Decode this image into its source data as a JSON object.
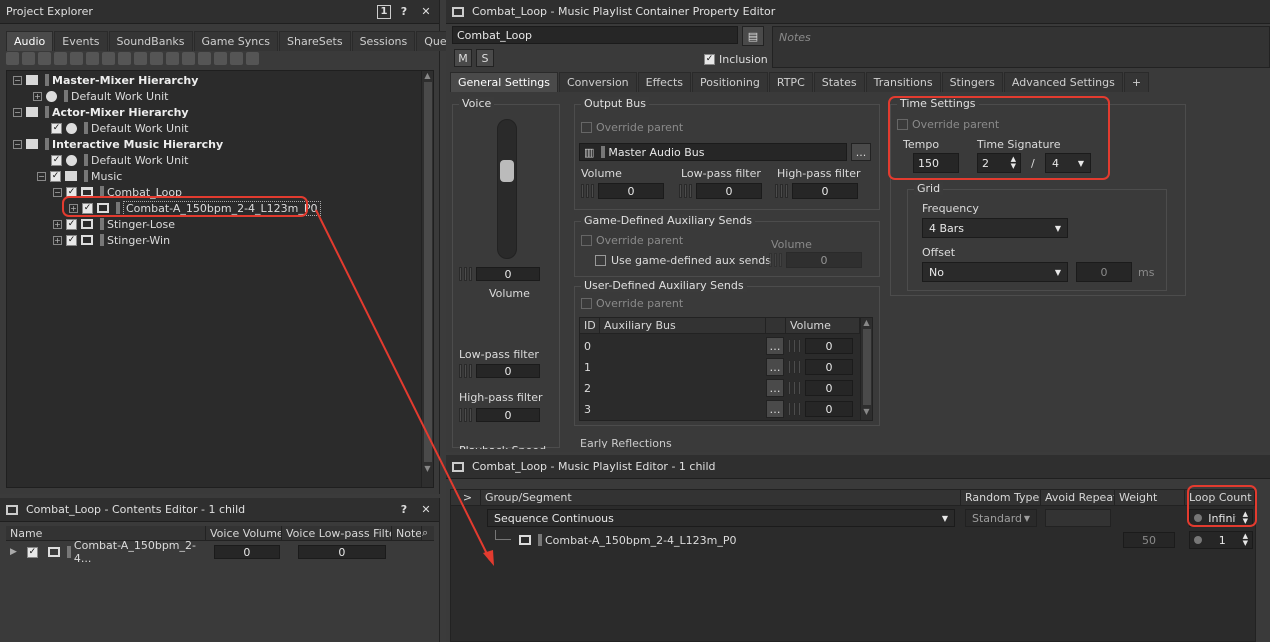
{
  "project_explorer": {
    "title": "Project Explorer",
    "title_btn_1": "1",
    "title_btn_help": "?",
    "title_btn_close": "✕",
    "tabs": [
      "Audio",
      "Events",
      "SoundBanks",
      "Game Syncs",
      "ShareSets",
      "Sessions",
      "Queries"
    ],
    "tree": [
      {
        "label": "Master-Mixer Hierarchy",
        "bold": true
      },
      {
        "label": "Default Work Unit"
      },
      {
        "label": "Actor-Mixer Hierarchy",
        "bold": true
      },
      {
        "label": "Default Work Unit"
      },
      {
        "label": "Interactive Music Hierarchy",
        "bold": true
      },
      {
        "label": "Default Work Unit"
      },
      {
        "label": "Music"
      },
      {
        "label": "Combat_Loop"
      },
      {
        "label": "Combat-A_150bpm_2-4_L123m_P0"
      },
      {
        "label": "Stinger-Lose"
      },
      {
        "label": "Stinger-Win"
      }
    ]
  },
  "contents_editor": {
    "title": "Combat_Loop - Contents Editor - 1 child",
    "help": "?",
    "close": "✕",
    "columns": [
      "Name",
      "Voice Volume",
      "Voice Low-pass Filter",
      "Notes"
    ],
    "row": {
      "name": "Combat-A_150bpm_2-4...",
      "volume": "0",
      "lpf": "0"
    }
  },
  "property_editor": {
    "title": "Combat_Loop - Music Playlist Container Property Editor",
    "name": "Combat_Loop",
    "mute": "M",
    "solo": "S",
    "inclusion": "Inclusion",
    "notes_placeholder": "Notes",
    "tabs": [
      "General Settings",
      "Conversion",
      "Effects",
      "Positioning",
      "RTPC",
      "States",
      "Transitions",
      "Stingers",
      "Advanced Settings",
      "+"
    ],
    "voice": {
      "title": "Voice",
      "volume_value": "0",
      "volume_label": "Volume",
      "lpf_label": "Low-pass filter",
      "lpf_value": "0",
      "hpf_label": "High-pass filter",
      "hpf_value": "0",
      "playback_label": "Playback Speed"
    },
    "output_bus": {
      "title": "Output Bus",
      "override": "Override parent",
      "bus": "Master Audio Bus",
      "browse": "...",
      "volume_label": "Volume",
      "volume": "0",
      "lpf_label": "Low-pass filter",
      "lpf": "0",
      "hpf_label": "High-pass filter",
      "hpf": "0"
    },
    "game_aux": {
      "title": "Game-Defined Auxiliary Sends",
      "override": "Override parent",
      "use": "Use game-defined aux sends",
      "volume_label": "Volume",
      "volume": "0"
    },
    "user_aux": {
      "title": "User-Defined Auxiliary Sends",
      "override": "Override parent",
      "columns": [
        "ID",
        "Auxiliary Bus",
        "Volume"
      ],
      "rows": [
        {
          "id": "0",
          "volume": "0"
        },
        {
          "id": "1",
          "volume": "0"
        },
        {
          "id": "2",
          "volume": "0"
        },
        {
          "id": "3",
          "volume": "0"
        }
      ]
    },
    "early_reflections": "Early Reflections",
    "time_settings": {
      "title": "Time Settings",
      "override": "Override parent",
      "tempo_label": "Tempo",
      "tempo": "150",
      "sig_label": "Time Signature",
      "sig_num": "2",
      "sig_slash": "/",
      "sig_den": "4"
    },
    "grid": {
      "title": "Grid",
      "freq_label": "Frequency",
      "freq": "4 Bars",
      "offset_label": "Offset",
      "offset": "No",
      "offset_value": "0",
      "offset_unit": "ms"
    }
  },
  "playlist_editor": {
    "title": "Combat_Loop - Music Playlist Editor - 1 child",
    "expander": ">",
    "columns": [
      "Group/Segment",
      "Random Type",
      "Avoid Repeat",
      "Weight",
      "Loop Count"
    ],
    "group": {
      "label": "Sequence Continuous",
      "random_type": "Standard",
      "loop": "Infinite"
    },
    "segment": {
      "label": "Combat-A_150bpm_2-4_L123m_P0",
      "weight": "50",
      "loop": "1"
    }
  }
}
